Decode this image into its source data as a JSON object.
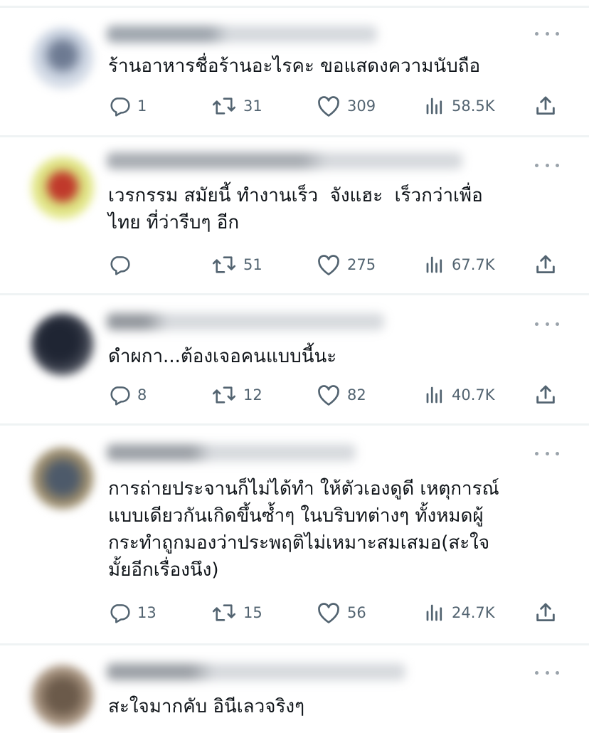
{
  "tweets": [
    {
      "text": "ร้านอาหารชื่อร้านอะไรคะ ขอแสดงความนับถือ",
      "replies": "1",
      "retweets": "31",
      "likes": "309",
      "views": "58.5K",
      "avatar_color": "#7b8aa6",
      "header_color": "#9aa2ad"
    },
    {
      "text": "เวรกรรม สมัยนี้ ทำงานเร็ว  จังแฮะ  เร็วกว่าเพื่อ\nไทย ที่ว่ารีบๆ อีก",
      "replies": "",
      "retweets": "51",
      "likes": "275",
      "views": "67.7K",
      "avatar_color": "#c0392b",
      "avatar_ring": "#e7f08a",
      "header_color": "#a3a9b0"
    },
    {
      "text": "ดำผกา...ต้องเจอคนแบบนี้นะ",
      "replies": "8",
      "retweets": "12",
      "likes": "82",
      "views": "40.7K",
      "avatar_color": "#2b2f3a",
      "header_color": "#9aa2ad"
    },
    {
      "text": "การถ่ายประจานก็ไม่ได้ทำ ให้ตัวเองดูดี เหตุการณ์\nแบบเดียวกันเกิดขึ้นซ้ำๆ ในบริบทต่างๆ ทั้งหมดผู้\nกระทำถูกมองว่าประพฤติไม่เหมาะสมเสมอ(สะใจ\nมั้ยอีกเรื่องนึง)",
      "replies": "13",
      "retweets": "15",
      "likes": "56",
      "views": "24.7K",
      "avatar_color": "#5b6b7a",
      "header_color": "#9aa2ad"
    },
    {
      "text": "สะใจมากคับ อินีเลวจริงๆ",
      "replies": "",
      "retweets": "",
      "likes": "",
      "views": "",
      "avatar_color": "#8a6e5a",
      "header_color": "#9aa2ad"
    }
  ],
  "icons": {
    "reply": "reply-icon",
    "retweet": "retweet-icon",
    "like": "heart-icon",
    "views": "views-icon",
    "share": "share-icon",
    "more": "more-icon"
  },
  "colors": {
    "text": "#0f1419",
    "muted": "#536471",
    "divider": "#eff3f4"
  }
}
